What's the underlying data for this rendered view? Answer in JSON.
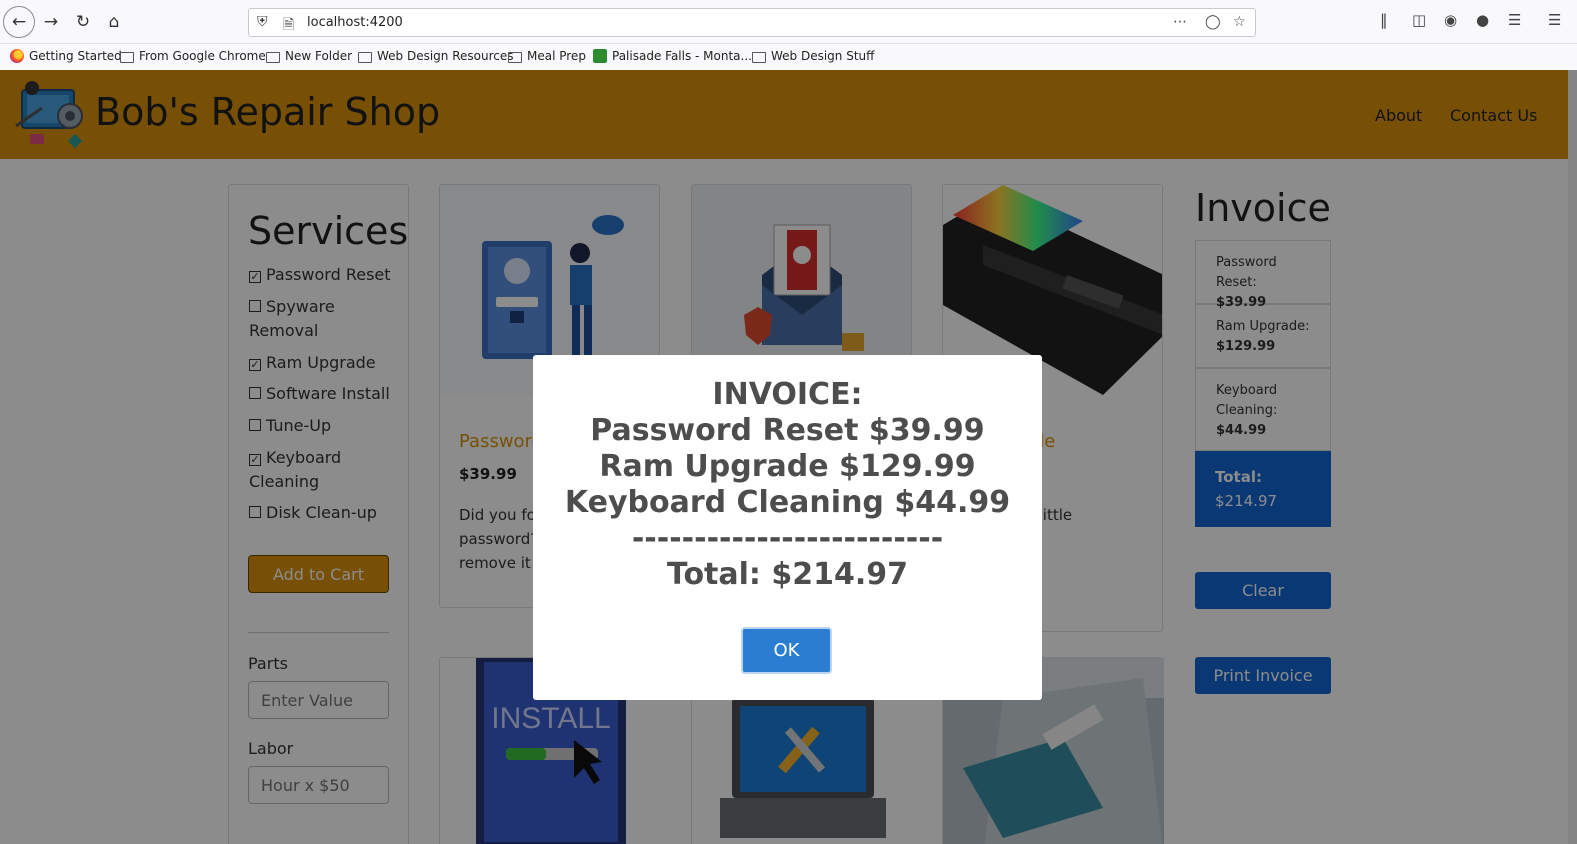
{
  "browser": {
    "url": "localhost:4200",
    "bookmarks": [
      "Getting Started",
      "From Google Chrome",
      "New Folder",
      "Web Design Resources",
      "Meal Prep",
      "Palisade Falls - Monta...",
      "Web Design Stuff"
    ]
  },
  "navbar": {
    "brand": "Bob's Repair Shop",
    "links": [
      "About",
      "Contact Us"
    ]
  },
  "sidebar": {
    "title": "Services",
    "services": [
      {
        "label": "Password Reset",
        "checked": true
      },
      {
        "label": "Spyware Removal",
        "checked": false
      },
      {
        "label": "Ram Upgrade",
        "checked": true
      },
      {
        "label": "Software Install",
        "checked": false
      },
      {
        "label": "Tune-Up",
        "checked": false
      },
      {
        "label": "Keyboard Cleaning",
        "checked": true
      },
      {
        "label": "Disk Clean-up",
        "checked": false
      }
    ],
    "add_to_cart": "Add to Cart",
    "parts_label": "Parts",
    "parts_placeholder": "Enter Value",
    "labor_label": "Labor",
    "labor_placeholder": "Hour x $50"
  },
  "cards": [
    {
      "title": "Passwore",
      "price": "$39.99",
      "desc": "Did you fo\npassword?\nremove it t"
    },
    {
      "title": "",
      "price": "",
      "desc": ""
    },
    {
      "title": "grade",
      "price": "",
      "desc": "running a little\nan add\ngive it a\nst."
    }
  ],
  "invoice": {
    "title": "Invoice",
    "items": [
      {
        "label": "Password Reset:",
        "price": "$39.99"
      },
      {
        "label": "Ram Upgrade:",
        "price": "$129.99"
      },
      {
        "label": "Keyboard Cleaning:",
        "price": "$44.99"
      }
    ],
    "total_label": "Total:",
    "total_value": "$214.97",
    "clear": "Clear",
    "print": "Print Invoice"
  },
  "modal": {
    "heading": "INVOICE:",
    "lines": [
      "Password Reset $39.99",
      "Ram Upgrade $129.99",
      "Keyboard Cleaning $44.99"
    ],
    "separator": "-------------------------",
    "total": "Total: $214.97",
    "ok": "OK"
  }
}
